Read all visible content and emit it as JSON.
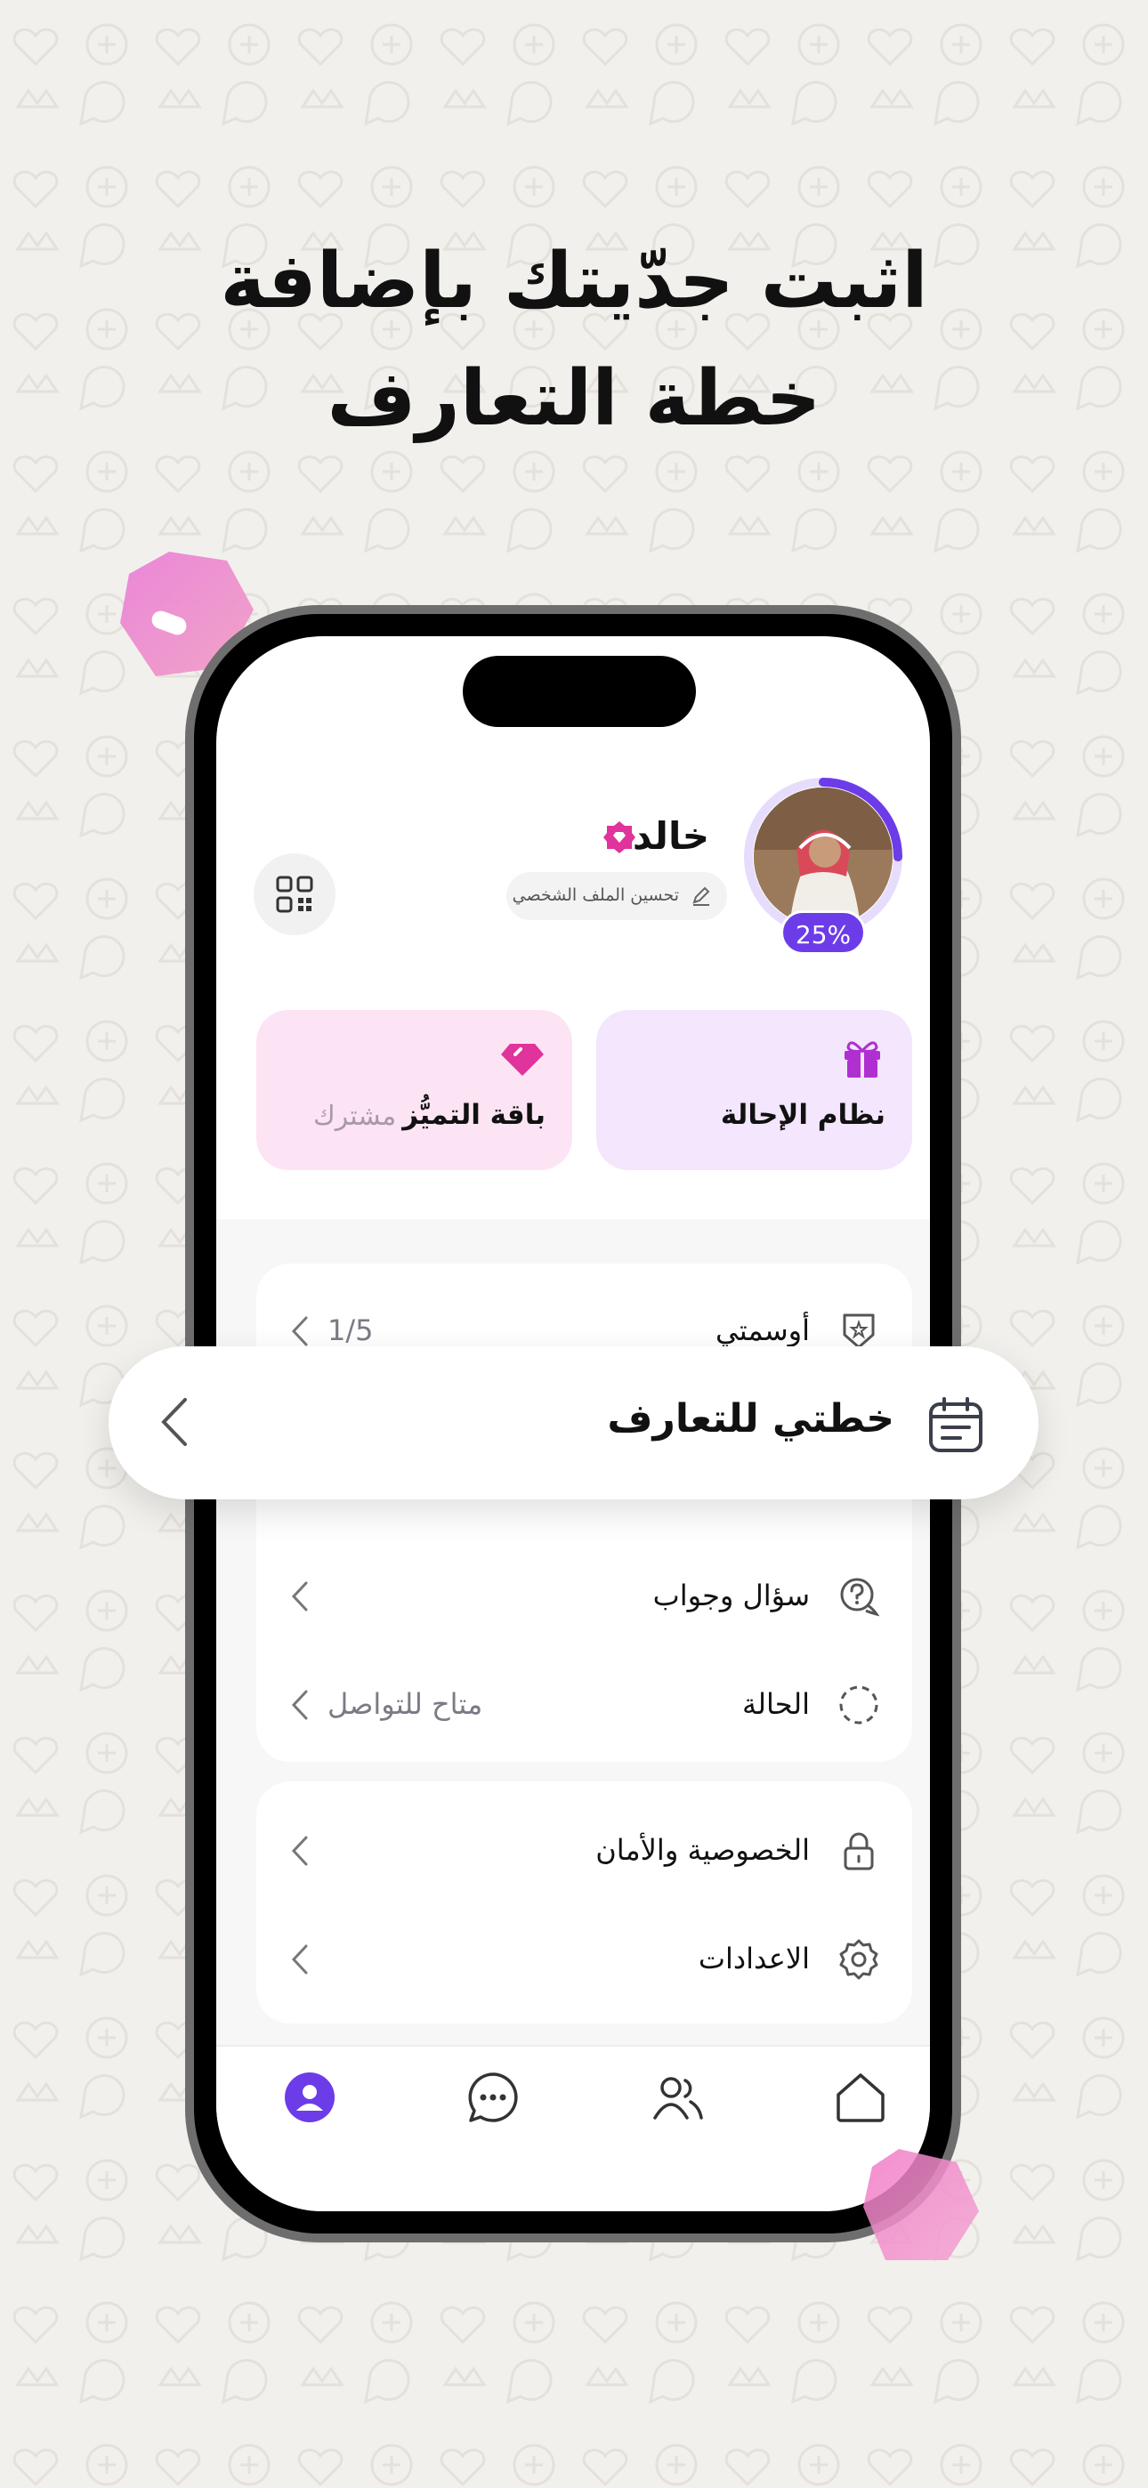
{
  "headline": {
    "line1": "اثبت جدّيتك بإضافة",
    "line2": "خطة التعارف"
  },
  "profile": {
    "name": "خالد",
    "progress": "25%",
    "progress_fraction": 0.25,
    "improve_label": "تحسين الملف الشخصي"
  },
  "cards": {
    "referral_title": "نظام الإحالة",
    "premium_title": "باقة التميُّز",
    "premium_status": "مشترك"
  },
  "menu": {
    "badges": {
      "label": "أوسمتي",
      "value": "1/5"
    },
    "qa": {
      "label": "سؤال وجواب"
    },
    "status": {
      "label": "الحالة",
      "value": "متاح للتواصل"
    },
    "privacy": {
      "label": "الخصوصية والأمان"
    },
    "settings": {
      "label": "الاعدادات"
    }
  },
  "floating": {
    "label": "خطتي للتعارف"
  },
  "colors": {
    "accent": "#6c3ce8",
    "pink": "#e0339b",
    "referral_bg": "#f3e6fd",
    "premium_bg": "#fde4f4"
  },
  "icons": {
    "nav": [
      "profile-icon",
      "chat-icon",
      "users-icon",
      "home-icon"
    ]
  }
}
